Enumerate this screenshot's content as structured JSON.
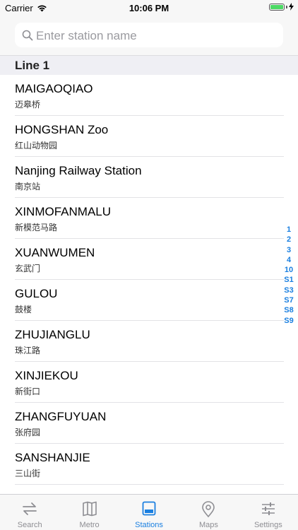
{
  "status_bar": {
    "carrier": "Carrier",
    "time": "10:06 PM"
  },
  "search": {
    "placeholder": "Enter station name"
  },
  "section": {
    "title": "Line 1"
  },
  "stations": [
    {
      "name": "MAIGAOQIAO",
      "cn": "迈皋桥"
    },
    {
      "name": "HONGSHAN Zoo",
      "cn": "红山动物园"
    },
    {
      "name": "Nanjing Railway Station",
      "cn": "南京站"
    },
    {
      "name": "XINMOFANMALU",
      "cn": "新模范马路"
    },
    {
      "name": "XUANWUMEN",
      "cn": "玄武门"
    },
    {
      "name": "GULOU",
      "cn": "鼓楼"
    },
    {
      "name": "ZHUJIANGLU",
      "cn": "珠江路"
    },
    {
      "name": "XINJIEKOU",
      "cn": "新街口"
    },
    {
      "name": "ZHANGFUYUAN",
      "cn": "张府园"
    },
    {
      "name": "SANSHANJIE",
      "cn": "三山街"
    }
  ],
  "index": [
    "1",
    "2",
    "3",
    "4",
    "10",
    "S1",
    "S3",
    "S7",
    "S8",
    "S9"
  ],
  "tabs": [
    {
      "label": "Search",
      "icon": "search-arrows-icon"
    },
    {
      "label": "Metro",
      "icon": "map-book-icon"
    },
    {
      "label": "Stations",
      "icon": "station-list-icon",
      "active": true
    },
    {
      "label": "Maps",
      "icon": "location-pin-icon"
    },
    {
      "label": "Settings",
      "icon": "sliders-icon"
    }
  ],
  "colors": {
    "accent": "#1a7fe0",
    "inactive": "#8e8e93",
    "battery": "#4cd964"
  }
}
